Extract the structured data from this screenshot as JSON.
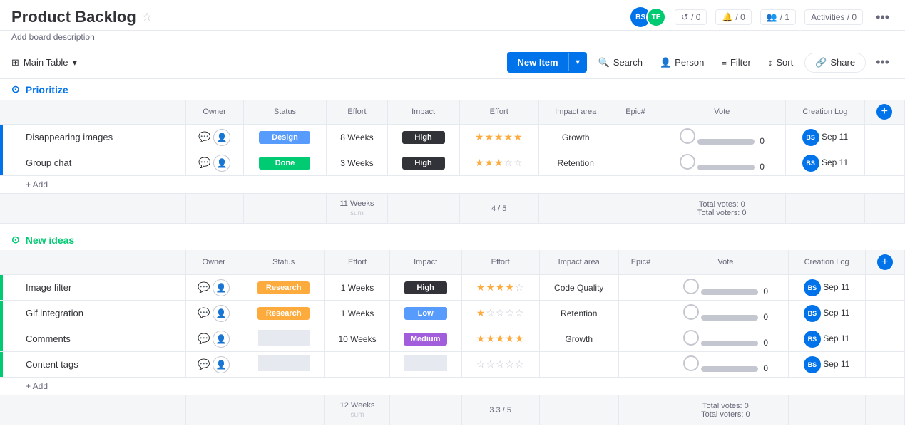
{
  "header": {
    "title": "Product Backlog",
    "description": "Add board description",
    "stats": {
      "updates": "/ 0",
      "inbox": "/ 0",
      "team": "/ 1",
      "activities": "Activities / 0"
    }
  },
  "toolbar": {
    "table_label": "Main Table",
    "new_item": "New Item",
    "search": "Search",
    "person": "Person",
    "filter": "Filter",
    "sort": "Sort",
    "share": "Share"
  },
  "sections": [
    {
      "id": "prioritize",
      "title": "Prioritize",
      "color": "#0073ea",
      "columns": [
        "Owner",
        "Status",
        "Effort",
        "Impact",
        "Effort",
        "Impact area",
        "Epic#",
        "Vote",
        "Creation Log"
      ],
      "rows": [
        {
          "name": "Disappearing images",
          "owner": "",
          "status": "Design",
          "status_class": "status-design",
          "effort": "8 Weeks",
          "impact": "High",
          "impact_class": "impact-high",
          "stars": 5,
          "impact_area": "Growth",
          "epic": "",
          "vote_count": 0,
          "creation_date": "Sep 11"
        },
        {
          "name": "Group chat",
          "owner": "",
          "status": "Done",
          "status_class": "status-done",
          "effort": "3 Weeks",
          "impact": "High",
          "impact_class": "impact-high",
          "stars": 3,
          "impact_area": "Retention",
          "epic": "",
          "vote_count": 0,
          "creation_date": "Sep 11"
        }
      ],
      "summary": {
        "effort_sum": "11 Weeks",
        "effort_label": "sum",
        "effort_ratio": "4 / 5",
        "total_votes": "Total votes: 0",
        "total_voters": "Total voters: 0"
      }
    },
    {
      "id": "new-ideas",
      "title": "New ideas",
      "color": "#00ca72",
      "columns": [
        "Owner",
        "Status",
        "Effort",
        "Impact",
        "Effort",
        "Impact area",
        "Epic#",
        "Vote",
        "Creation Log"
      ],
      "rows": [
        {
          "name": "Image filter",
          "owner": "",
          "status": "Research",
          "status_class": "status-research",
          "effort": "1 Weeks",
          "impact": "High",
          "impact_class": "impact-high",
          "stars": 4,
          "impact_area": "Code Quality",
          "epic": "",
          "vote_count": 0,
          "creation_date": "Sep 11"
        },
        {
          "name": "Gif integration",
          "owner": "",
          "status": "Research",
          "status_class": "status-research",
          "effort": "1 Weeks",
          "impact": "Low",
          "impact_class": "impact-low",
          "stars": 1,
          "impact_area": "Retention",
          "epic": "",
          "vote_count": 0,
          "creation_date": "Sep 11"
        },
        {
          "name": "Comments",
          "owner": "",
          "status": "",
          "status_class": "status-empty",
          "effort": "10 Weeks",
          "impact": "Medium",
          "impact_class": "impact-medium",
          "stars": 5,
          "impact_area": "Growth",
          "epic": "",
          "vote_count": 0,
          "creation_date": "Sep 11"
        },
        {
          "name": "Content tags",
          "owner": "",
          "status": "",
          "status_class": "status-empty",
          "effort": "",
          "impact": "",
          "impact_class": "impact-empty",
          "stars": 0,
          "impact_area": "",
          "epic": "",
          "vote_count": 0,
          "creation_date": "Sep 11"
        }
      ],
      "summary": {
        "effort_sum": "12 Weeks",
        "effort_label": "sum",
        "effort_ratio": "3.3 / 5",
        "total_votes": "Total votes: 0",
        "total_voters": "Total voters: 0"
      }
    }
  ],
  "add_label": "+ Add",
  "icons": {
    "star_filled": "★",
    "star_empty": "☆",
    "chevron_down": "▾",
    "table_icon": "⊞",
    "more": "•••",
    "search": "🔍",
    "person": "👤",
    "filter": "≡",
    "sort": "↕",
    "share": "🔗"
  }
}
